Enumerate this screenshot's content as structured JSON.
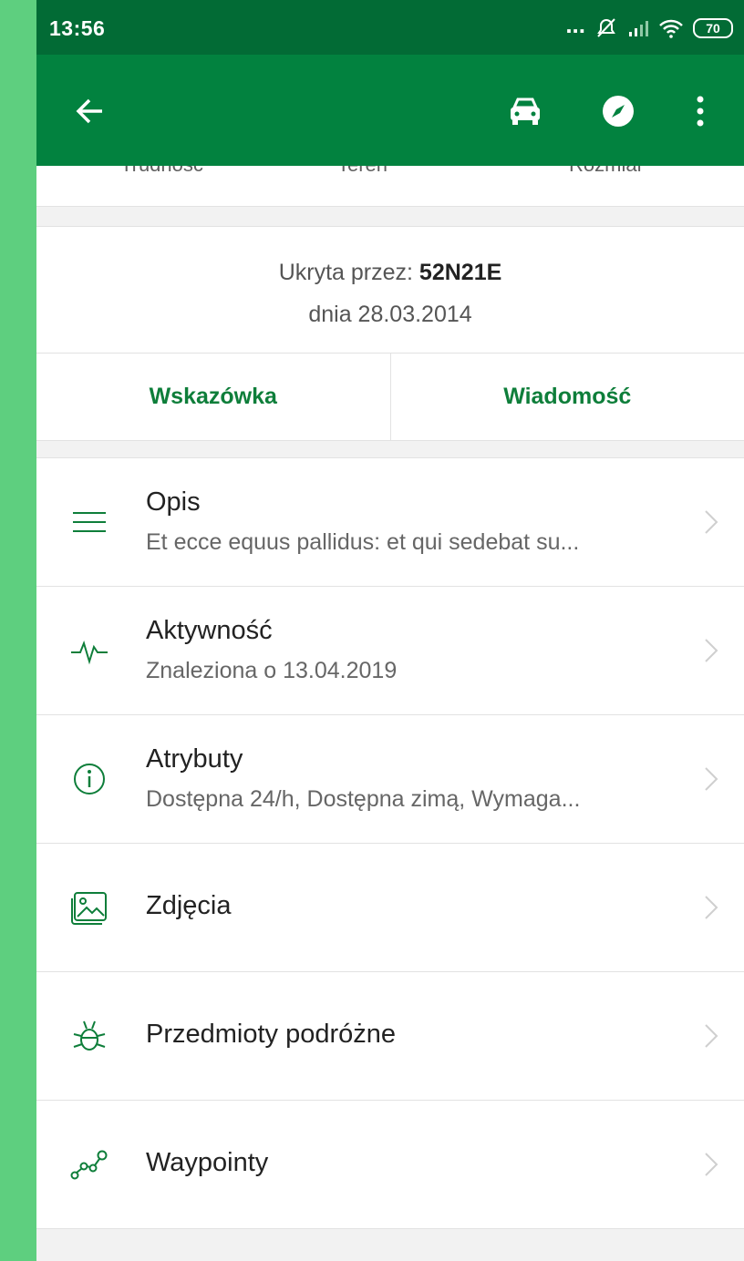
{
  "status_bar": {
    "time": "13:56",
    "battery": "70",
    "more_dots": "..."
  },
  "toolbar": {
    "icons": [
      "arrow-left-icon",
      "car-icon",
      "compass-icon",
      "more-vertical-icon"
    ]
  },
  "stats_labels": [
    "Trudność",
    "Teren",
    "Rozmiar"
  ],
  "owner": {
    "prefix": "Ukryta przez: ",
    "name": "52N21E",
    "date": "dnia 28.03.2014"
  },
  "actions": {
    "hint": "Wskazówka",
    "message": "Wiadomość"
  },
  "list": [
    {
      "icon": "menu-lines-icon",
      "title": "Opis",
      "subtitle": "Et ecce equus pallidus: et qui sedebat su..."
    },
    {
      "icon": "activity-icon",
      "title": "Aktywność",
      "subtitle": "Znaleziona o 13.04.2019"
    },
    {
      "icon": "info-icon",
      "title": "Atrybuty",
      "subtitle": "Dostępna 24/h, Dostępna zimą, Wymaga..."
    },
    {
      "icon": "image-icon",
      "title": "Zdjęcia"
    },
    {
      "icon": "bug-icon",
      "title": "Przedmioty podróżne"
    },
    {
      "icon": "waypoints-icon",
      "title": "Waypointy"
    }
  ],
  "colors": {
    "accent": "#02823f",
    "status_bar": "#026b35",
    "text_green": "#0e7e3a",
    "frame_bg": "#5ecf7f"
  }
}
